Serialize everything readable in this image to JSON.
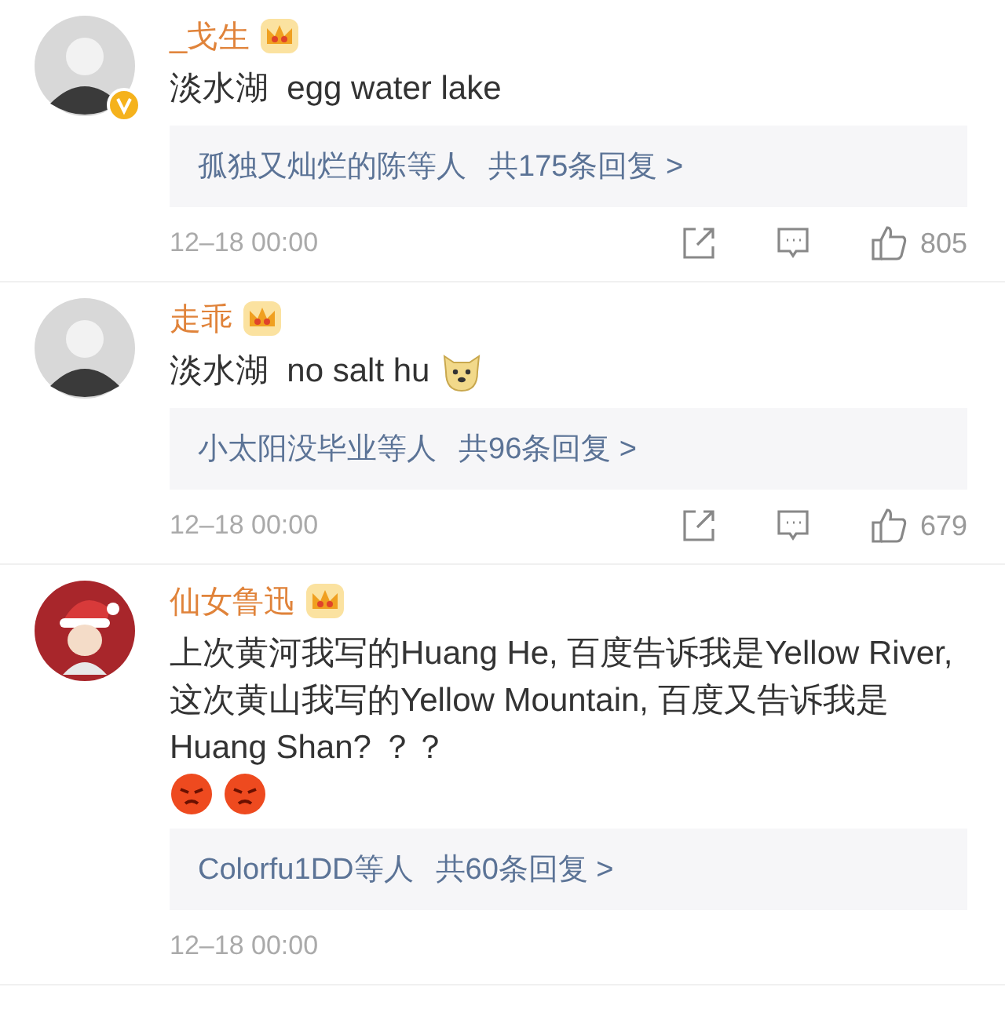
{
  "comments": [
    {
      "name": "_戈生",
      "vip": true,
      "verified": true,
      "avatar": {
        "kind": "photo"
      },
      "text": "淡水湖  egg water lake",
      "replies": {
        "who": "孤独又灿烂的陈等人",
        "count": "共175条回复 >"
      },
      "time": "12–18 00:00",
      "likes": "805"
    },
    {
      "name": "走乖",
      "vip": true,
      "verified": false,
      "avatar": {
        "kind": "photo"
      },
      "text": "淡水湖  no salt hu",
      "emoji": [
        {
          "kind": "doge"
        }
      ],
      "replies": {
        "who": "小太阳没毕业等人",
        "count": "共96条回复 >"
      },
      "time": "12–18 00:00",
      "likes": "679"
    },
    {
      "name": "仙女鲁迅",
      "vip": true,
      "verified": false,
      "avatar": {
        "kind": "cartoon"
      },
      "text": "上次黄河我写的Huang He, 百度告诉我是Yellow River, 这次黄山我写的Yellow Mountain, 百度又告诉我是Huang Shan? ？？",
      "emoji": [
        {
          "kind": "angry"
        },
        {
          "kind": "angry"
        }
      ],
      "replies": {
        "who": "Colorfu1DD等人",
        "count": "共60条回复 >"
      },
      "time": "12–18 00:00"
    }
  ]
}
